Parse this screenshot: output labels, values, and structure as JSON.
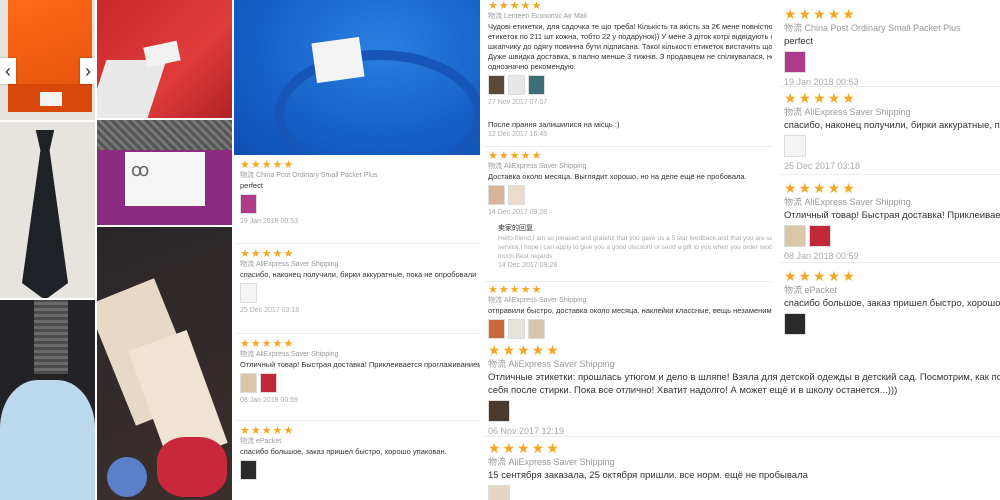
{
  "ui": {
    "arrows": {
      "left": "‹",
      "right": "›"
    },
    "purple_label_glyph": "ꝏ"
  },
  "colors": {
    "stars": "#f5a623",
    "meta": "#999999",
    "date": "#aaaaaa"
  },
  "icons": [
    "chevron-left-icon",
    "chevron-right-icon",
    "star-icon"
  ],
  "reviews_top_middle": [
    {
      "stars": "★★★★★",
      "shipping": "Lenteen Economic Air Mail",
      "text1": "Чудові етикетки, для садочка те що треба! Кількість та якість за 2€ мене повністю влаштовують, я отримала 2 мож",
      "text2": "етикеток по 211 шт кожна, тобто 22 у подарунок)) У мене 3 діток котрі відвідують садочок і за правилами садка кож",
      "text3": "шкапчику до одягу повинна бути підписана. Такої кількості етикеток вистачить щоб позначити все, ще й залишиться",
      "text4": "Дуже швидка доставка, в пално менше 3 тижнів. З продавцем не спілкувалася, не було потреби. Товар і магазин",
      "text5": "однозначно рекомендую.",
      "date": "27 Nov 2017 07:07"
    },
    {
      "text": "После прання залишилися на місць :)",
      "date": "12 Dec 2017 16:45"
    },
    {
      "stars": "★★★★★",
      "shipping": "AliExpress Saver Shipping",
      "text": "Доставка около месяца. Выглядит хорошо, но на деле ещё не пробовала.",
      "date": "14 Dec 2017 09:28",
      "reply_label": "卖家的回复",
      "reply1": "Hello friend,I am so pleased and grateful that you gave us a 5 star feedback,and that you are satisfied with our produ",
      "reply2": "service.I hope i can apply to give you a good discount or send a gift to you when you order next time.Thank you very",
      "reply3": "much.Best regards",
      "reply_date": "14 Dec 2017 09:28"
    },
    {
      "stars": "★★★★★",
      "shipping": "AliExpress Saver Shipping",
      "text": "отправили быстро, доставка около месяца, наклейки классные, вещь незаменимая."
    }
  ],
  "reviews_left": [
    {
      "stars": "★★★★★",
      "shipping": "China Post Ordinary Small Packet Plus",
      "text": "perfect",
      "date": "19 Jan 2018 00:53"
    },
    {
      "stars": "★★★★★",
      "shipping": "AliExpress Saver Shipping",
      "text": "спасибо, наконец получили, бирки аккуратные, пока не опробовали",
      "date": "25 Dec 2017 03:18"
    },
    {
      "stars": "★★★★★",
      "shipping": "AliExpress Saver Shipping",
      "text": "Отличный товар! Быстрая доставка! Приклеивается проглаживанием. Реком",
      "date": "08 Jan 2018 00:59"
    },
    {
      "stars": "★★★★★",
      "shipping": "ePacket",
      "text": "спасибо большое, заказ пришел быстро, хорошо упакован."
    }
  ],
  "reviews_right": [
    {
      "stars": "★★★★★",
      "shipping": "China Post Ordinary Small Packet Plus",
      "text": "perfect",
      "date": "19 Jan 2018 00:53"
    },
    {
      "stars": "★★★★★",
      "shipping": "AliExpress Saver Shipping",
      "text": "спасибо, наконец получили, бирки аккуратные, пока не опробовали",
      "date": "25 Dec 2017 03:18"
    },
    {
      "stars": "★★★★★",
      "shipping": "AliExpress Saver Shipping",
      "text": "Отличный товар! Быстрая доставка! Приклеивается проглаживани",
      "date": "08 Jan 2018 00:59"
    },
    {
      "stars": "★★★★★",
      "shipping": "ePacket",
      "text": "спасибо большое, заказ пришел быстро, хорошо упакован."
    }
  ],
  "reviews_bottom": [
    {
      "stars": "★★★★★",
      "shipping": "AliExpress Saver Shipping",
      "text1": "Отличные этикетки: прошлась утюгом и дело в шляпе! Взяла для детской одежды в детский сад. Посмотрим, как поведу",
      "text2": "себя после стирки. Пока все отлично! Хватит надолго! А может ещё и в школу останется...)))",
      "date": "06 Nov 2017 12:19"
    },
    {
      "stars": "★★★★★",
      "shipping": "AliExpress Saver Shipping",
      "text": "15 сентября заказала, 25 октября пришли. все норм. ещё не пробывала"
    }
  ],
  "ship_prefix": "物流"
}
